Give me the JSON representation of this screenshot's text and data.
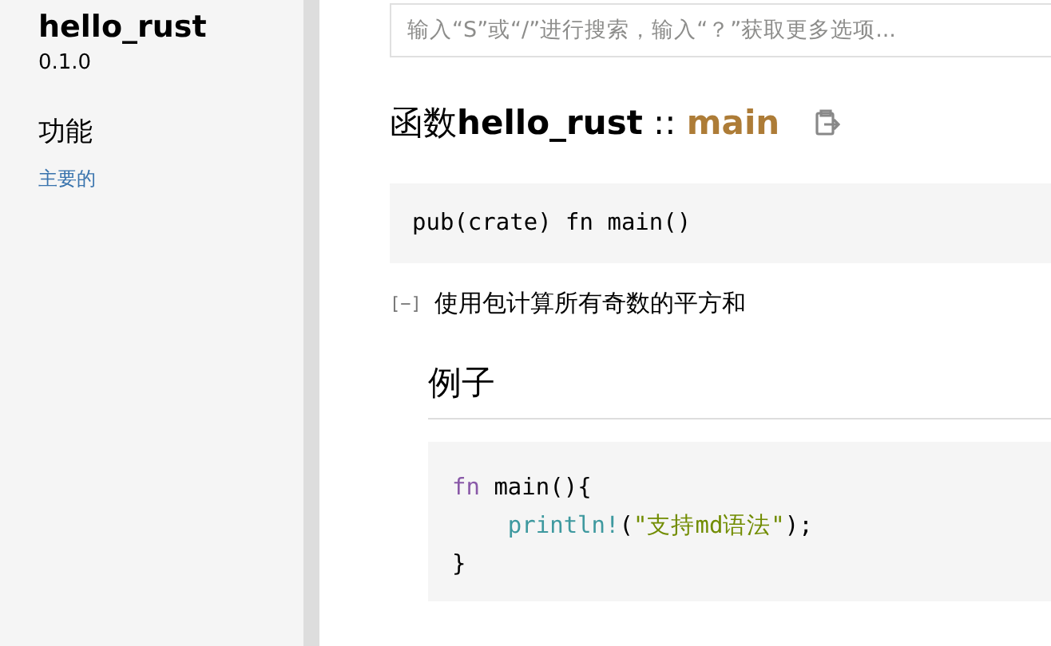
{
  "sidebar": {
    "crate_name": "hello_rust",
    "version": "0.1.0",
    "section_title": "功能",
    "items": [
      {
        "label": "主要的"
      }
    ]
  },
  "search": {
    "placeholder": "输入“S”或“/”进行搜索，输入“？”获取更多选项..."
  },
  "heading": {
    "kind_label": "函数",
    "path": "hello_rust",
    "separator": "::",
    "name": "main"
  },
  "signature": "pub(crate) fn main()",
  "docblock": {
    "toggle": "[−]",
    "expanded": true,
    "summary": "使用包计算所有奇数的平方和",
    "section_heading": "例子",
    "code_lines": [
      {
        "indented": false,
        "tokens": [
          {
            "kind": "keyword",
            "text": "fn"
          },
          {
            "kind": "plain",
            "text": " main(){"
          }
        ]
      },
      {
        "indented": true,
        "tokens": [
          {
            "kind": "macro",
            "text": "println!"
          },
          {
            "kind": "plain",
            "text": "("
          },
          {
            "kind": "string",
            "text": "\"支持md语法\""
          },
          {
            "kind": "plain",
            "text": ");"
          }
        ]
      },
      {
        "indented": false,
        "tokens": [
          {
            "kind": "plain",
            "text": "}"
          }
        ]
      }
    ]
  }
}
